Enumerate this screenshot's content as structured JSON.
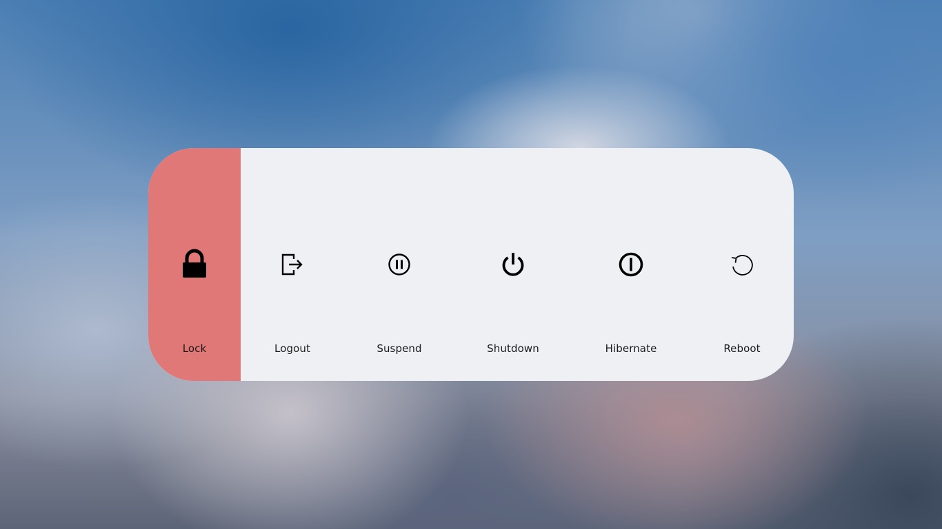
{
  "menu": {
    "selected": "lock",
    "selected_color": "#df7876",
    "panel_color": "#eff0f4",
    "items": [
      {
        "id": "lock",
        "label": "Lock",
        "icon": "lock-icon"
      },
      {
        "id": "logout",
        "label": "Logout",
        "icon": "logout-icon"
      },
      {
        "id": "suspend",
        "label": "Suspend",
        "icon": "pause-circle-icon"
      },
      {
        "id": "shutdown",
        "label": "Shutdown",
        "icon": "power-icon"
      },
      {
        "id": "hibernate",
        "label": "Hibernate",
        "icon": "hibernate-icon"
      },
      {
        "id": "reboot",
        "label": "Reboot",
        "icon": "reboot-icon"
      }
    ]
  }
}
